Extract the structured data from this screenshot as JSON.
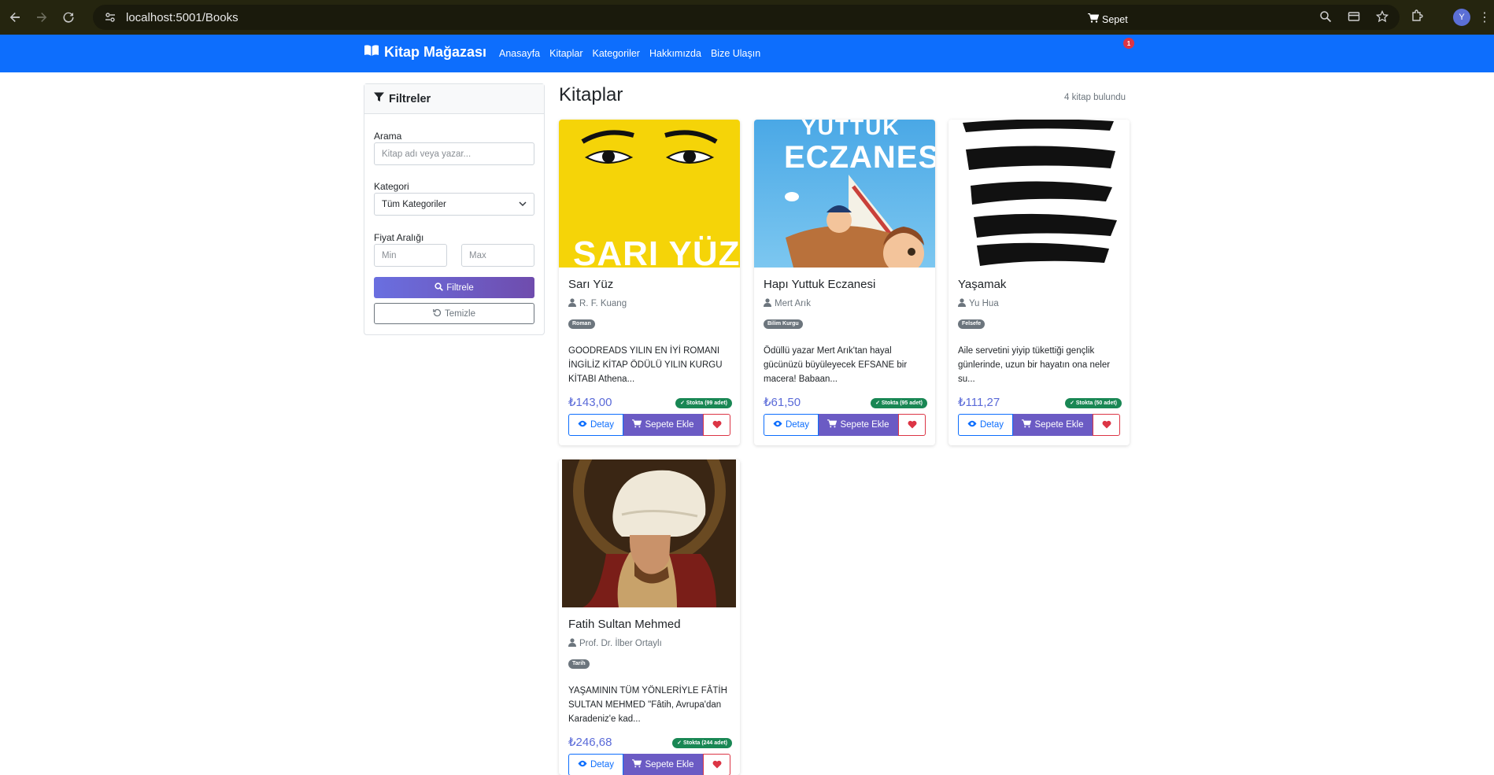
{
  "browser": {
    "url": "localhost:5001/Books",
    "profile_initial": "Y"
  },
  "navbar": {
    "brand": "Kitap Mağazası",
    "links": [
      "Anasayfa",
      "Kitaplar",
      "Kategoriler",
      "Hakkımızda",
      "Bize Ulaşın"
    ],
    "cart_label": "Sepet",
    "cart_count": "1"
  },
  "filters": {
    "title": "Filtreler",
    "search_label": "Arama",
    "search_placeholder": "Kitap adı veya yazar...",
    "category_label": "Kategori",
    "category_selected": "Tüm Kategoriler",
    "price_label": "Fiyat Aralığı",
    "min_placeholder": "Min",
    "max_placeholder": "Max",
    "filter_button": "Filtrele",
    "clear_button": "Temizle"
  },
  "main": {
    "title": "Kitaplar",
    "count_text": "4 kitap bulundu"
  },
  "books": [
    {
      "title": "Sarı Yüz",
      "author": "R. F. Kuang",
      "category": "Roman",
      "description": "GOODREADS YILIN EN İYİ ROMANI İNGİLİZ KİTAP ÖDÜLÜ YILIN KURGU KİTABI Athena...",
      "price": "₺143,00",
      "stock": "✓ Stokta (99 adet)",
      "cover_text": "SARI YÜZ"
    },
    {
      "title": "Hapı Yuttuk Eczanesi",
      "author": "Mert Arık",
      "category": "Bilim Kurgu",
      "description": "Ödüllü yazar Mert Arık'tan hayal gücünüzü büyüleyecek EFSANE bir macera! Babaan...",
      "price": "₺61,50",
      "stock": "✓ Stokta (95 adet)",
      "cover_text_top": "YUTTUK",
      "cover_text_main": "ECZANESİ"
    },
    {
      "title": "Yaşamak",
      "author": "Yu Hua",
      "category": "Felsefe",
      "description": "Aile servetini yiyip tükettiği gençlik günlerinde, uzun bir hayatın ona neler su...",
      "price": "₺111,27",
      "stock": "✓ Stokta (50 adet)"
    },
    {
      "title": "Fatih Sultan Mehmed",
      "author": "Prof. Dr. İlber Ortaylı",
      "category": "Tarih",
      "description": "YAŞAMININ TÜM YÖNLERİYLE FÂTİH SULTAN MEHMED \"Fâtih, Avrupa'dan Karadeniz'e kad...",
      "price": "₺246,68",
      "stock": "✓ Stokta (244 adet)"
    }
  ],
  "card_buttons": {
    "detail": "Detay",
    "add_to_cart": "Sepete Ekle"
  },
  "colors": {
    "navbar": "#0d6efd",
    "price": "#5a6ad8",
    "cart_button": "#6b5bc4",
    "stock_badge": "#198754",
    "favorite": "#dc3545"
  }
}
